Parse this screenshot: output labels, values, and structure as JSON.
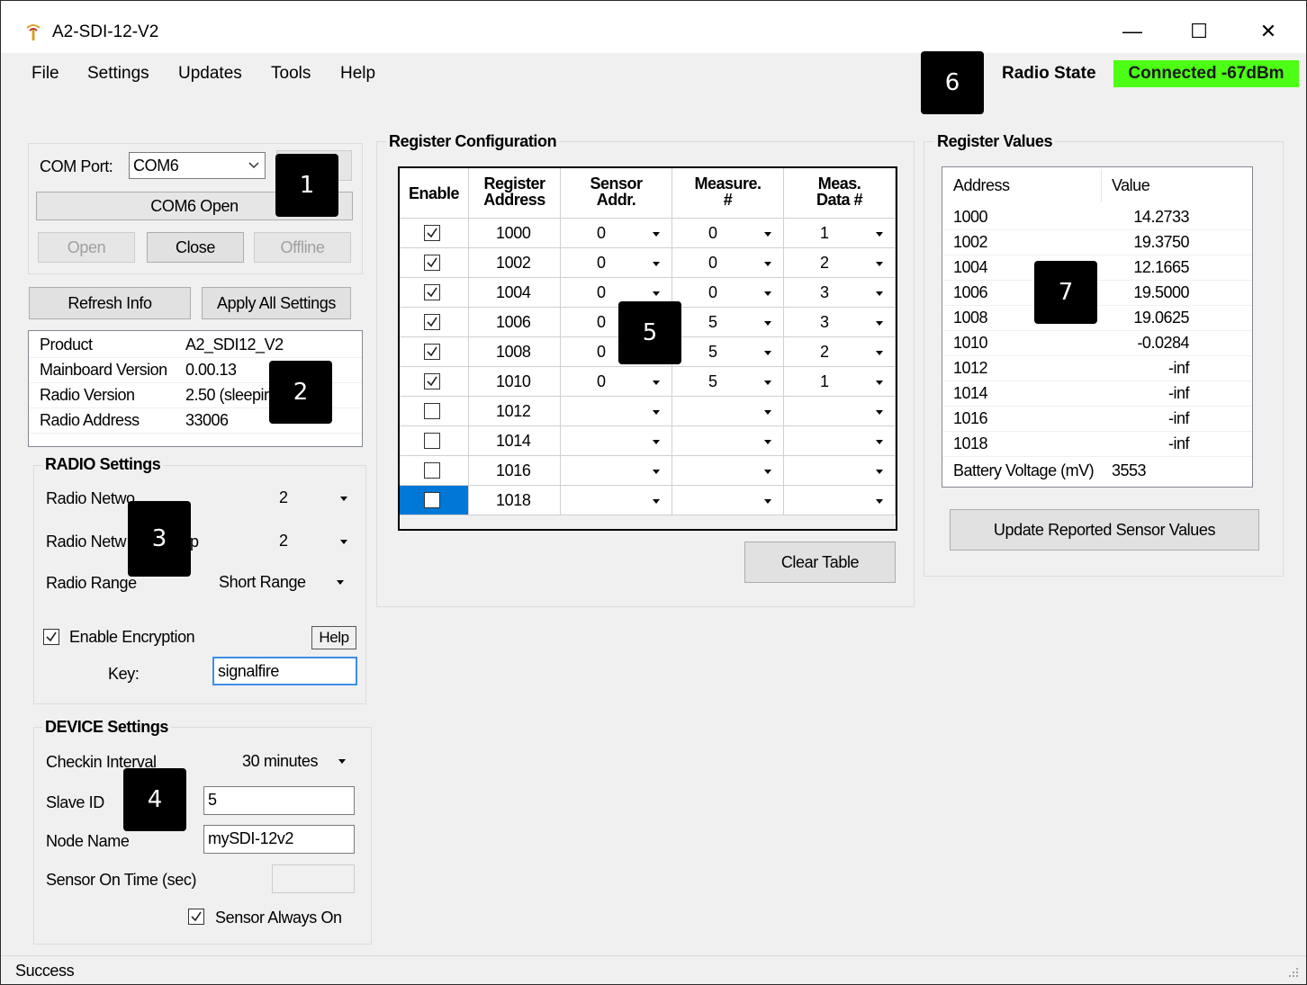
{
  "window": {
    "title": "A2-SDI-12-V2",
    "minimize": "—",
    "maximize": "☐",
    "close": "✕"
  },
  "menu": [
    "File",
    "Settings",
    "Updates",
    "Tools",
    "Help"
  ],
  "radio_state": {
    "label": "Radio State",
    "value": "Connected -67dBm",
    "color": "#4cff14"
  },
  "markers": [
    "1",
    "2",
    "3",
    "4",
    "5",
    "6",
    "7"
  ],
  "com": {
    "port_label": "COM Port:",
    "port_value": "COM6",
    "status": "COM6 Open",
    "open": "Open",
    "close": "Close",
    "offline": "Offline"
  },
  "actions": {
    "refresh": "Refresh Info",
    "apply_all": "Apply All Settings"
  },
  "info": [
    {
      "key": "Product",
      "value": "A2_SDI12_V2"
    },
    {
      "key": "Mainboard Version",
      "value": "0.00.13"
    },
    {
      "key": "Radio Version",
      "value": "2.50 (sleepir"
    },
    {
      "key": "Radio Address",
      "value": "33006"
    }
  ],
  "radio_settings": {
    "title": "RADIO Settings",
    "network_label": "Radio Netwo",
    "network_value": "2",
    "group_label_a": "Radio Netw",
    "group_label_b": "p",
    "group_value": "2",
    "range_label": "Radio Range",
    "range_value": "Short Range",
    "encryption_label": "Enable Encryption",
    "encryption_checked": true,
    "help": "Help",
    "key_label": "Key:",
    "key_value": "signalfire"
  },
  "device_settings": {
    "title": "DEVICE Settings",
    "checkin_label": "Checkin Interval",
    "checkin_value": "30 minutes",
    "slave_label": "Slave ID",
    "slave_value": "5",
    "node_label": "Node Name",
    "node_value": "mySDI-12v2",
    "sensor_on_label": "Sensor On Time (sec)",
    "sensor_on_value": "",
    "always_on_label": "Sensor Always On",
    "always_on_checked": true
  },
  "register_config": {
    "title": "Register Configuration",
    "headers": [
      "Enable",
      "Register\nAddress",
      "Sensor\nAddr.",
      "Measure.\n#",
      "Meas.\nData #"
    ],
    "rows": [
      {
        "enabled": true,
        "address": "1000",
        "sensor": "0",
        "measure": "0",
        "data": "1"
      },
      {
        "enabled": true,
        "address": "1002",
        "sensor": "0",
        "measure": "0",
        "data": "2"
      },
      {
        "enabled": true,
        "address": "1004",
        "sensor": "0",
        "measure": "0",
        "data": "3"
      },
      {
        "enabled": true,
        "address": "1006",
        "sensor": "0",
        "measure": "5",
        "data": "3"
      },
      {
        "enabled": true,
        "address": "1008",
        "sensor": "0",
        "measure": "5",
        "data": "2"
      },
      {
        "enabled": true,
        "address": "1010",
        "sensor": "0",
        "measure": "5",
        "data": "1"
      },
      {
        "enabled": false,
        "address": "1012",
        "sensor": "",
        "measure": "",
        "data": ""
      },
      {
        "enabled": false,
        "address": "1014",
        "sensor": "",
        "measure": "",
        "data": ""
      },
      {
        "enabled": false,
        "address": "1016",
        "sensor": "",
        "measure": "",
        "data": ""
      },
      {
        "enabled": false,
        "address": "1018",
        "sensor": "",
        "measure": "",
        "data": ""
      }
    ],
    "clear": "Clear Table"
  },
  "register_values": {
    "title": "Register Values",
    "headers": [
      "Address",
      "Value"
    ],
    "rows": [
      {
        "address": "1000",
        "value": "14.2733"
      },
      {
        "address": "1002",
        "value": "19.3750"
      },
      {
        "address": "1004",
        "value": "12.1665"
      },
      {
        "address": "1006",
        "value": "19.5000"
      },
      {
        "address": "1008",
        "value": "19.0625"
      },
      {
        "address": "1010",
        "value": "-0.0284"
      },
      {
        "address": "1012",
        "value": "-inf"
      },
      {
        "address": "1014",
        "value": "-inf"
      },
      {
        "address": "1016",
        "value": "-inf"
      },
      {
        "address": "1018",
        "value": "-inf"
      }
    ],
    "battery_label": "Battery Voltage (mV)",
    "battery_value": "3553",
    "update": "Update Reported Sensor Values"
  },
  "status": "Success"
}
